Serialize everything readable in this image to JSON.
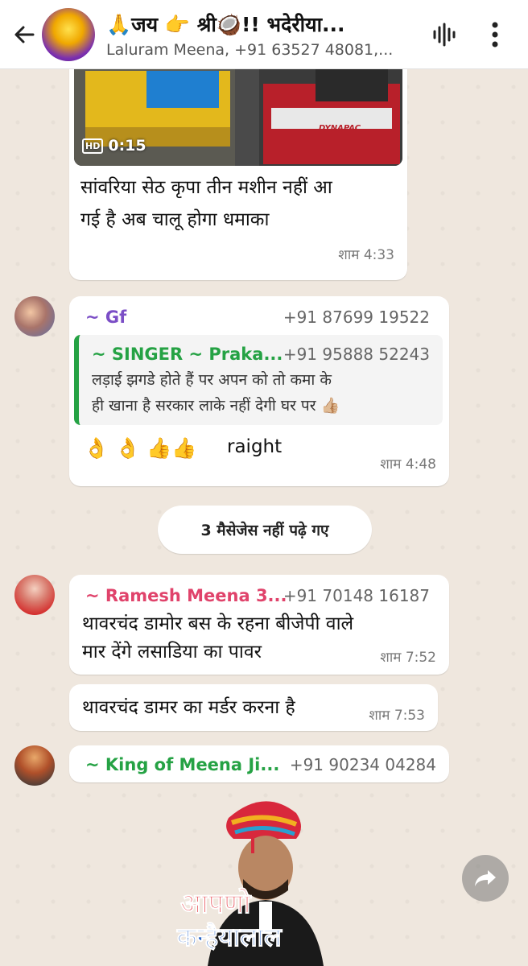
{
  "header": {
    "title": "🙏जय 👉 श्री🥥!! भदेरीया...",
    "subtitle": "Laluram Meena, +91 63527 48081,..."
  },
  "video_message": {
    "duration": "0:15",
    "hd_label": "HD",
    "brand": "DYNAPAC",
    "text_line1": "सांवरिया सेठ कृपा तीन मशीन नहीं आ",
    "text_line2": "गई है अब चालू होगा धमाका",
    "time": "शाम 4:33"
  },
  "reply_message": {
    "sender": "~ Gf",
    "phone": "+91 87699 19522",
    "quote_sender": "~ SINGER ~ Praka...",
    "quote_phone": "+91 95888 52243",
    "quote_line1": "लड़ाई झगडे होते हैं पर अपन को तो कमा के",
    "quote_line2": "ही खाना है सरकार लाके नहीं देगी घर पर 👍🏼",
    "emojis": "👌 👌 👍👍",
    "text": "raight",
    "time": "शाम 4:48"
  },
  "unread_banner": "3 मैसेजेस नहीं पढ़े गए",
  "ramesh_message": {
    "sender": "~ Ramesh Meena 3...",
    "phone": "+91 70148 16187",
    "line1": "थावरचंद डामोर बस के रहना बीजेपी वाले",
    "line2": "मार देंगे लसाडिया का पावर",
    "time": "शाम 7:52"
  },
  "ramesh_message2": {
    "text": "थावरचंद डामर का मर्डर करना है",
    "time": "शाम 7:53"
  },
  "king_message": {
    "sender": "~ King of Meena Ji...",
    "phone": "+91 90234 04284"
  },
  "sticker": {
    "line1": "आपणो",
    "line2": "कन्हैयालाल"
  },
  "colors": {
    "gf_sender": "#7b4ec6",
    "singer_sender": "#25a244",
    "ramesh_sender": "#e0436b",
    "king_sender": "#25a244"
  }
}
